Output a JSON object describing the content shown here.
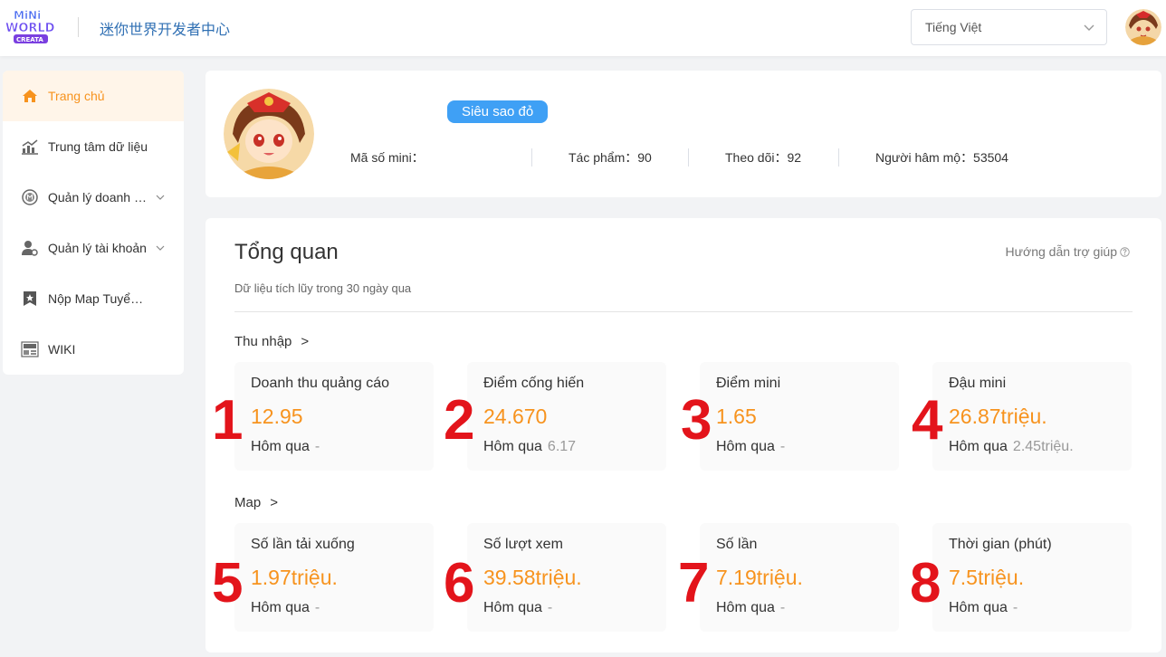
{
  "header": {
    "logo_text": [
      "MiNi",
      "WORLD",
      "CREATA"
    ],
    "site_title": "迷你世界开发者中心",
    "language": "Tiếng Việt",
    "avatar_icon": "user-avatar-icon"
  },
  "sidebar": {
    "items": [
      {
        "label": "Trang chủ",
        "icon": "home-icon",
        "active": true
      },
      {
        "label": "Trung tâm dữ liệu",
        "icon": "chart-icon"
      },
      {
        "label": "Quản lý doanh thu",
        "icon": "coin-icon",
        "caret": true
      },
      {
        "label": "Quản lý tài khoản",
        "icon": "user-settings-icon",
        "caret": true
      },
      {
        "label": "Nộp Map Tuyển chọn",
        "icon": "star-bookmark-icon"
      },
      {
        "label": "WIKI",
        "icon": "wiki-icon"
      }
    ]
  },
  "profile": {
    "badge": "Siêu sao đỏ",
    "stats": [
      {
        "label": "Mã số mini：",
        "value": ""
      },
      {
        "label": "Tác phẩm：",
        "value": "90"
      },
      {
        "label": "Theo dõi：",
        "value": "92"
      },
      {
        "label": "Người hâm mộ：",
        "value": "53504"
      }
    ]
  },
  "overview": {
    "title": "Tổng quan",
    "help": "Hướng dẫn trợ giúp",
    "subtitle": "Dữ liệu tích lũy trong 30 ngày qua",
    "sections": [
      {
        "title": "Thu nhập",
        "arrow": ">",
        "metrics": [
          {
            "label": "Doanh thu quảng cáo",
            "value": "12.95",
            "foot": "Hôm qua",
            "prev": "-",
            "marker": "1"
          },
          {
            "label": "Điểm cống hiến",
            "value": "24.670",
            "foot": "Hôm qua",
            "prev": "6.17",
            "marker": "2"
          },
          {
            "label": "Điểm mini",
            "value": "1.65",
            "foot": "Hôm qua",
            "prev": "-",
            "marker": "3"
          },
          {
            "label": "Đậu mini",
            "value": "26.87triệu.",
            "foot": "Hôm qua",
            "prev": "2.45triệu.",
            "marker": "4"
          }
        ]
      },
      {
        "title": "Map",
        "arrow": ">",
        "metrics": [
          {
            "label": "Số lần tải xuống",
            "value": "1.97triệu.",
            "foot": "Hôm qua",
            "prev": "-",
            "marker": "5"
          },
          {
            "label": "Số lượt xem",
            "value": "39.58triệu.",
            "foot": "Hôm qua",
            "prev": "-",
            "marker": "6"
          },
          {
            "label": "Số lần",
            "value": "7.19triệu.",
            "foot": "Hôm qua",
            "prev": "-",
            "marker": "7"
          },
          {
            "label": "Thời gian (phút)",
            "value": "7.5triệu.",
            "foot": "Hôm qua",
            "prev": "-",
            "marker": "8"
          }
        ]
      }
    ]
  },
  "colors": {
    "accent": "#f7931e",
    "marker": "#e3141b",
    "badge": "#3fa0f5",
    "title_blue": "#2f6fb3"
  }
}
